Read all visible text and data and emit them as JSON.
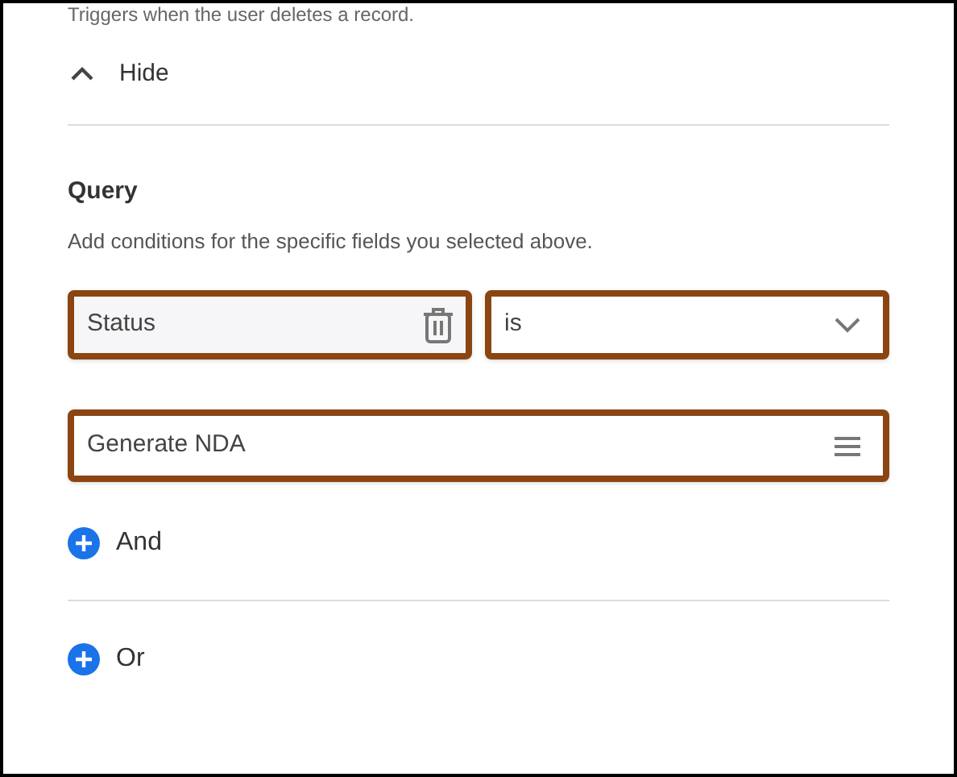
{
  "trigger_description": "Triggers when the user deletes a record.",
  "toggle": {
    "label": "Hide",
    "expanded": true
  },
  "query": {
    "title": "Query",
    "description": "Add conditions for the specific fields you selected above.",
    "conditions": [
      {
        "field": "Status",
        "operator": "is",
        "value": "Generate NDA",
        "highlighted": true
      }
    ]
  },
  "add_buttons": [
    {
      "label": "And"
    },
    {
      "label": "Or"
    }
  ]
}
